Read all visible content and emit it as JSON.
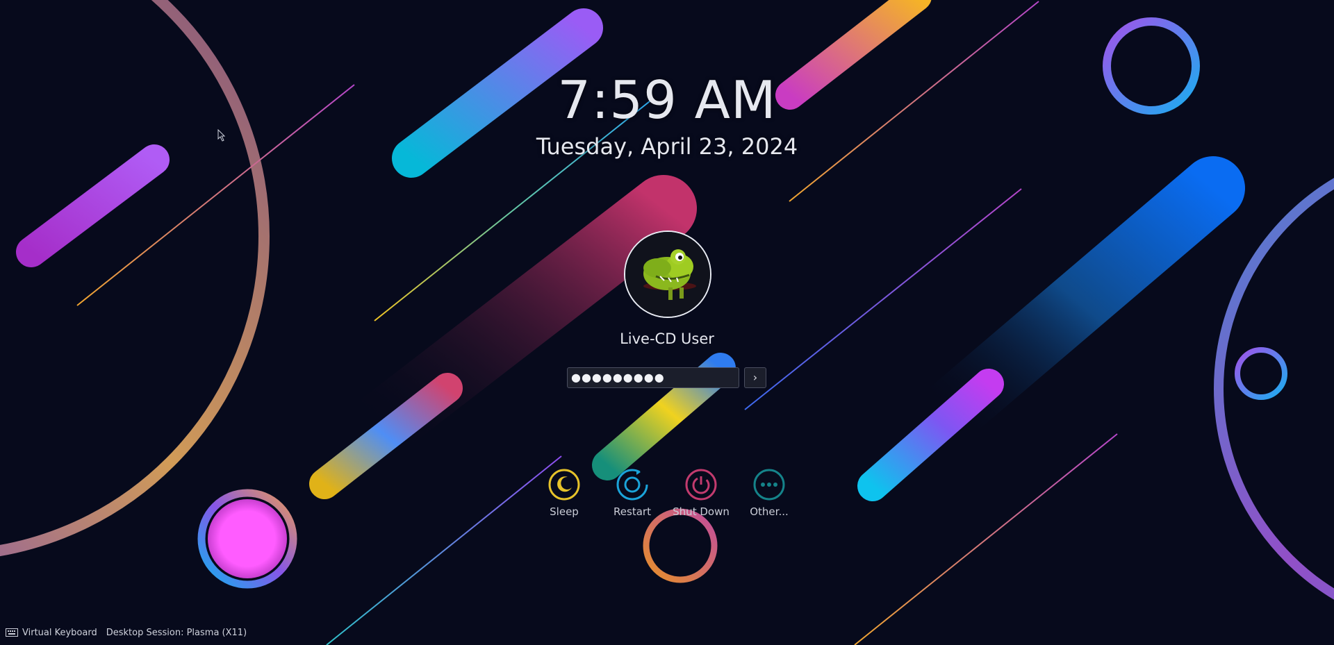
{
  "lockscreen": {
    "time": "7:59 AM",
    "date": "Tuesday, April 23, 2024",
    "username": "Live-CD User",
    "password_mask": "●●●●●●●●●",
    "login_arrow": "›"
  },
  "actions": [
    {
      "label": "Sleep",
      "color": "#e6c22a"
    },
    {
      "label": "Restart",
      "color": "#1ba3d9"
    },
    {
      "label": "Shut Down",
      "color": "#c23b6e"
    },
    {
      "label": "Other...",
      "color": "#15838a"
    }
  ],
  "footer": {
    "virtual_keyboard": "Virtual Keyboard",
    "desktop_session": "Desktop Session: Plasma (X11)"
  }
}
